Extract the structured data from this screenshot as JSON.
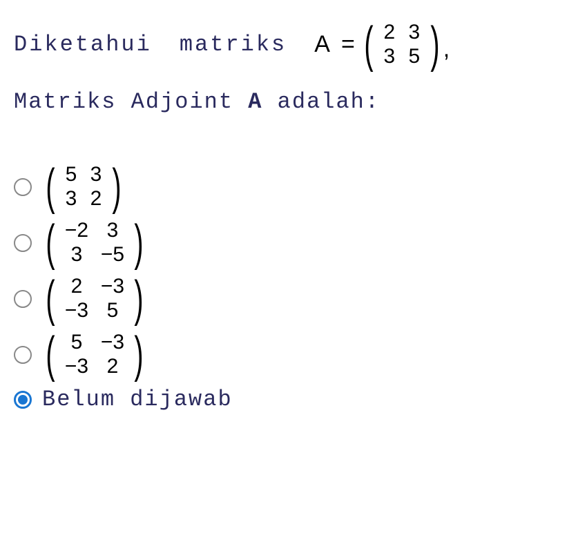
{
  "question": {
    "text1": "Diketahui",
    "text2": "matriks",
    "variable": "A",
    "equals": "=",
    "matrix_given": {
      "r1c1": "2",
      "r1c2": "3",
      "r2c1": "3",
      "r2c2": "5"
    },
    "comma": ","
  },
  "line2": {
    "pre": "Matriks Adjoint ",
    "bold": "A",
    "post": " adalah:"
  },
  "options": [
    {
      "matrix": {
        "r1c1": "5",
        "r1c2": "3",
        "r2c1": "3",
        "r2c2": "2"
      },
      "wide": false
    },
    {
      "matrix": {
        "r1c1": "−2",
        "r1c2": "3",
        "r2c1": "3",
        "r2c2": "−5"
      },
      "wide": true
    },
    {
      "matrix": {
        "r1c1": "2",
        "r1c2": "−3",
        "r2c1": "−3",
        "r2c2": "5"
      },
      "wide": true
    },
    {
      "matrix": {
        "r1c1": "5",
        "r1c2": "−3",
        "r2c1": "−3",
        "r2c2": "2"
      },
      "wide": true
    }
  ],
  "last_option": {
    "label": "Belum dijawab",
    "selected": true
  }
}
